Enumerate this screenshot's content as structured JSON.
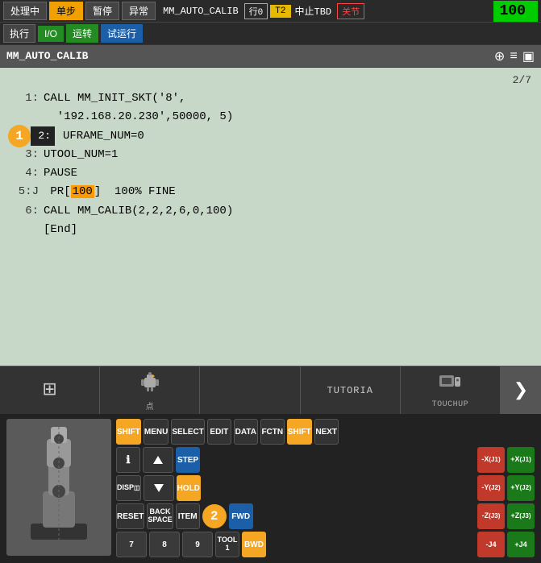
{
  "topToolbar": {
    "btn1": "处理中",
    "btn2": "单步",
    "btn3": "暂停",
    "btn4": "异常",
    "btn5": "执行",
    "btn6": "I/O",
    "btn7": "运转",
    "btn8": "试运行",
    "statusProgram": "MM_AUTO_CALIB",
    "statusLine": "行0",
    "statusTag": "T2",
    "statusStop": "中止TBD",
    "statusClose": "关节",
    "percent": "100",
    "percentSuffix": "%"
  },
  "titleBar": {
    "title": "MM_AUTO_CALIB",
    "pageNum": "2/7"
  },
  "codeLines": [
    {
      "num": "1:",
      "content": "CALL MM_INIT_SKT('8',"
    },
    {
      "num": " ",
      "content": "  '192.168.20.230',50000, 5)"
    },
    {
      "num": "2:",
      "content": "UFRAME_NUM=0",
      "highlight": true
    },
    {
      "num": "3:",
      "content": "UTOOL_NUM=1"
    },
    {
      "num": "4:",
      "content": "PAUSE"
    },
    {
      "num": "5:J",
      "content": " PR[100]  100% FINE",
      "has100": true
    },
    {
      "num": "6:",
      "content": "CALL MM_CALIB(2,2,2,6,0,100)"
    },
    {
      "num": "[End]",
      "content": ""
    }
  ],
  "bottomNav": {
    "items": [
      {
        "icon": "⊞",
        "label": ""
      },
      {
        "icon": "🤖",
        "label": "点"
      },
      {
        "icon": "",
        "label": ""
      },
      {
        "icon": "",
        "label": "TUTORIA"
      },
      {
        "icon": "🖐",
        "label": "TOUCHUP"
      }
    ],
    "arrow": "❯"
  },
  "keyboard": {
    "row1": [
      "SHIFT",
      "MENU",
      "SELECT",
      "EDIT",
      "DATA",
      "FCTN",
      "SHIFT",
      "NEXT"
    ],
    "row2_left": [
      "ℹ",
      "↑",
      "STEP"
    ],
    "row2_right": [
      "-X\n(J1)",
      "+X\n(J1)"
    ],
    "row3_left": [
      "DISP",
      "↓",
      "HOLD"
    ],
    "row3_right": [
      "-Y\n(J2)",
      "+Y\n(J2)"
    ],
    "row4": [
      "RESET",
      "BACK\nSPACE",
      "ITEM",
      "FWD"
    ],
    "row4_right": [
      "-Z\n(J3)",
      "+Z\n(J3)"
    ],
    "row5": [
      "7",
      "8",
      "9",
      "TOOL\n1",
      "BWD"
    ],
    "row5_right": [
      "-J4",
      "+J4"
    ],
    "circle2label": "2"
  }
}
